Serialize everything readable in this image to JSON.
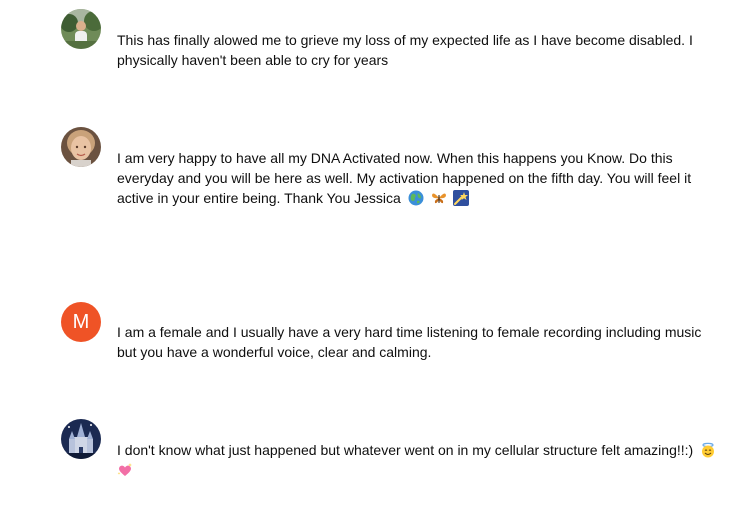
{
  "comments": [
    {
      "avatar_icon": "user-photo-outdoor",
      "text": "This has finally alowed me to grieve my loss of my expected life as I have become disabled. I physically haven't been able to cry for years"
    },
    {
      "avatar_icon": "user-photo-woman",
      "text": "I am very happy to have all my DNA Activated now. When this happens you Know. Do this everyday and you will be here as well. My activation happened on the fifth day. You will feel it active in your entire being. Thank You Jessica",
      "emojis": [
        "globe-emoji",
        "butterfly-emoji",
        "shooting-star-emoji"
      ]
    },
    {
      "avatar_letter": "M",
      "avatar_color": "#ef5326",
      "text": "I am a female and I usually have a very hard time listening to female recording including music but you have a wonderful voice, clear and calming."
    },
    {
      "avatar_icon": "user-photo-castle",
      "text": "I don't know what just happened but whatever went on in my cellular structure felt amazing!!:)",
      "emojis": [
        "smiling-halo-emoji",
        "sparkling-heart-emoji"
      ]
    }
  ]
}
